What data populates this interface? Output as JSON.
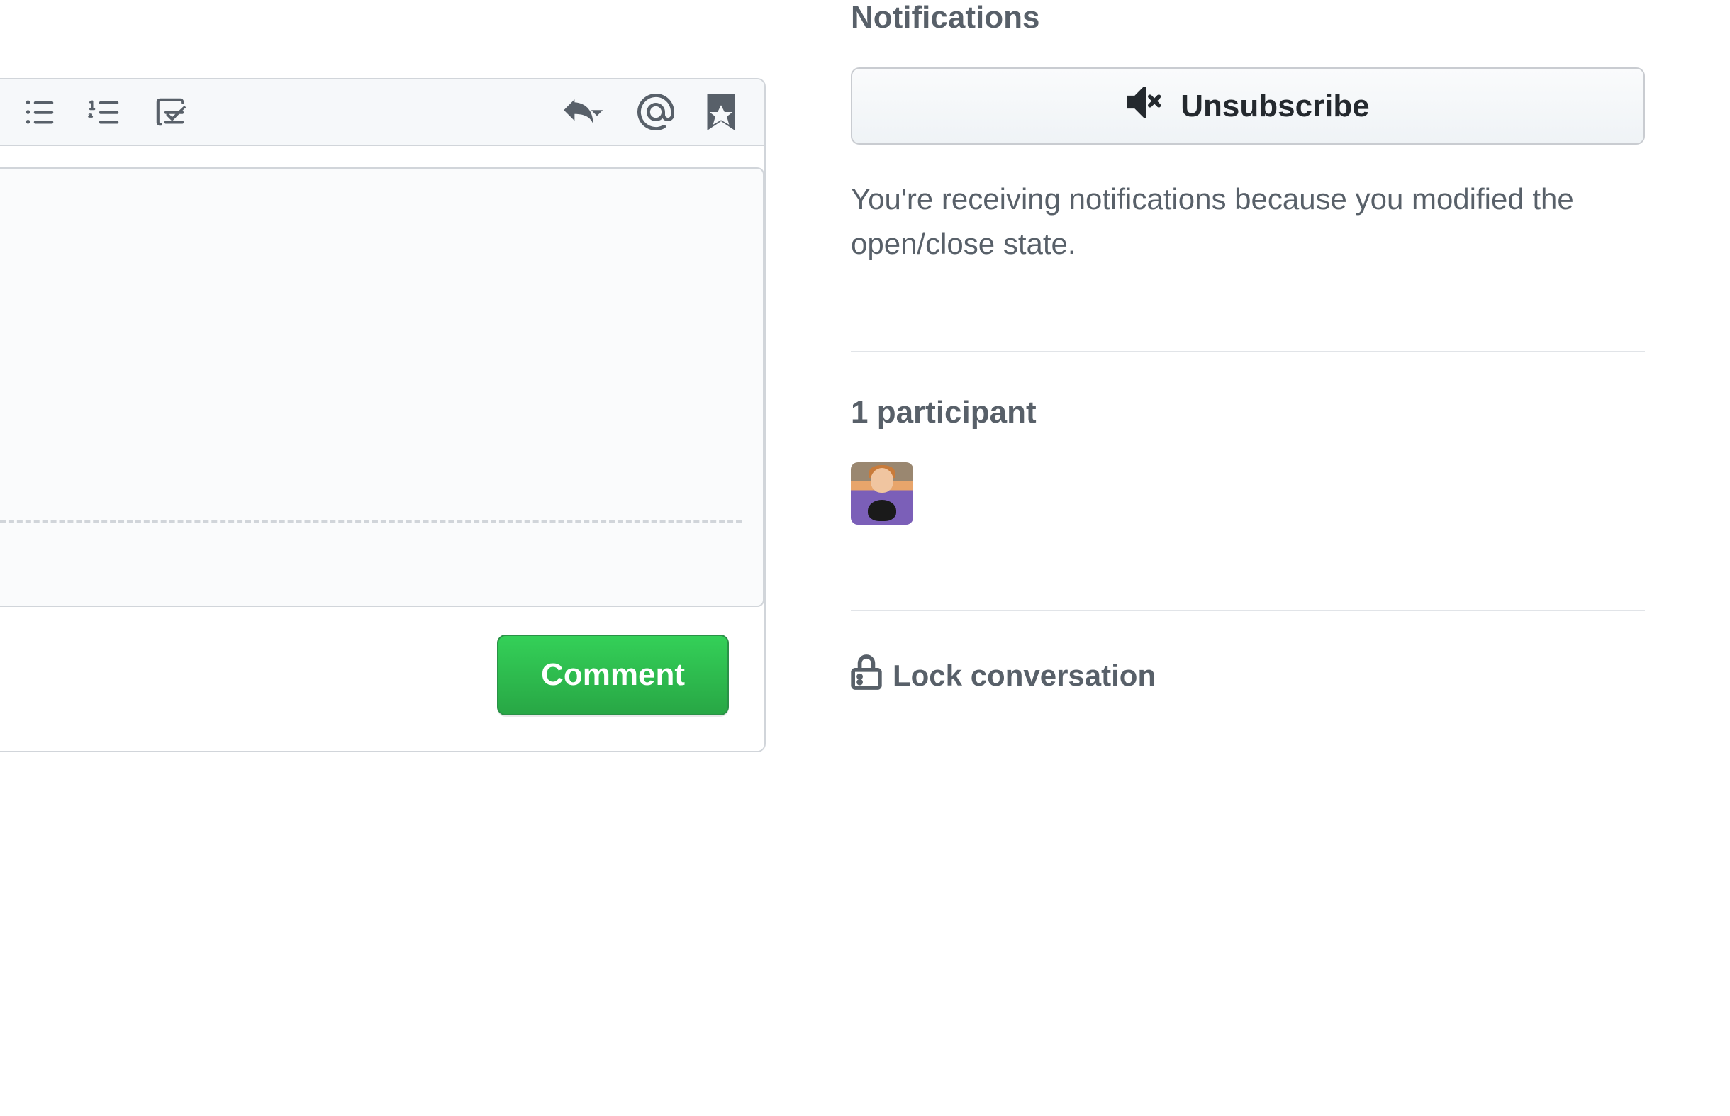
{
  "comment_form": {
    "textarea_value": "",
    "comment_button_label": "Comment"
  },
  "sidebar": {
    "notifications": {
      "heading": "Notifications",
      "unsubscribe_label": "Unsubscribe",
      "reason_text": "You're receiving notifications because you modified the open/close state."
    },
    "participants": {
      "heading": "1 participant"
    },
    "lock": {
      "label": "Lock conversation"
    }
  }
}
